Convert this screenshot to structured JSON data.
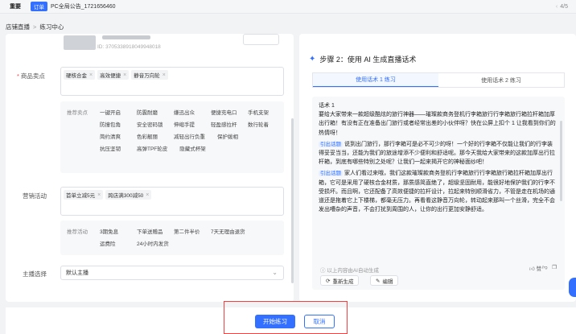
{
  "notice": {
    "important_label": "重要",
    "tag": "订单",
    "text": "PC全局公告_1721656460",
    "pager": "4/5"
  },
  "breadcrumb": {
    "root": "店铺直播",
    "current": "练习中心"
  },
  "product": {
    "id_text": "ID: 3705338918049948018"
  },
  "selling_points": {
    "label": "商品卖点",
    "chips": [
      "硬核合金",
      "高效便捷",
      "静音万向轮"
    ],
    "recommend_label": "推荐卖点",
    "recommend": [
      "一键开启",
      "防震耐磨",
      "嫌迅出众",
      "便捷充电口",
      "手机支架",
      "防撞包角",
      "安全密码锁",
      "伸缩手提",
      "轻盈感拉杆",
      "数行轮着",
      "简约清爽",
      "色彩靓丽",
      "减轻出行负重",
      "保护拨相",
      "抗压坚韧",
      "高弹TPF轮皮",
      "隐藏式杯架"
    ]
  },
  "marketing": {
    "label": "营销活动",
    "chips": [
      "首单立减5元",
      "跨店满300减50"
    ],
    "recommend_label": "推荐活动",
    "recommend": [
      "3期免息",
      "下单送赠品",
      "第二件半价",
      "7天无理由退货",
      "运费险",
      "24小时内发货"
    ]
  },
  "anchor": {
    "label": "主播选择",
    "value": "默认主播"
  },
  "step": {
    "title": "步骤 2：使用 AI 生成直播话术",
    "tabs": [
      "使用话术 1 练习",
      "使用话术 2 练习"
    ]
  },
  "script": {
    "title": "话术 1",
    "p1": "要给大家带来一款超级酷炫的旅行神器——璀璨款商务登机行李箱旅行行李箱旅行箱拉杆箱加厚出行箱！有没有正在准备出门旅行或者经常出差的小伙伴呀？快在公屏上扣个 1 让我看到你们的热情呀！",
    "badge": "引出话题",
    "p2": "说到出门旅行，那行李箱可是必不可少的呀！一个好的行李箱不仅能让我们的行李装得妥妥当当，还能为我们的旅途增添不少便利和舒适呢。那今天我给大家带来的这款加厚出行拉杆箱，到底有哪些特别之处呢？让我们一起来揭开它的神秘面纱吧！",
    "p3": "家人们看过来哦，我们这款璀璨款商务登机行李箱旅行行李箱旅行箱拉杆箱加厚出行箱，它可是采用了硬核合金材质，那质感简直绝了，超级坚固耐用，能很好地保护我们的行李不受损坏。而且啊，它还配备了高效便捷的拉杆设计，拉起来特别顺滑省力，不管是走在机场的通道还是拖着它上下楼梯，都毫无压力。再看看这静音万向轮，转动起来那叫一个丝滑，完全不会发出嘈杂的声音，不会打扰到周围的人，让你的出行更加安静舒适。",
    "footnote": "以上内容由AI自动生成",
    "like": "赞",
    "regenerate": "重新生成",
    "edit": "编辑"
  },
  "actions": {
    "start": "开始练习",
    "cancel": "取消"
  }
}
